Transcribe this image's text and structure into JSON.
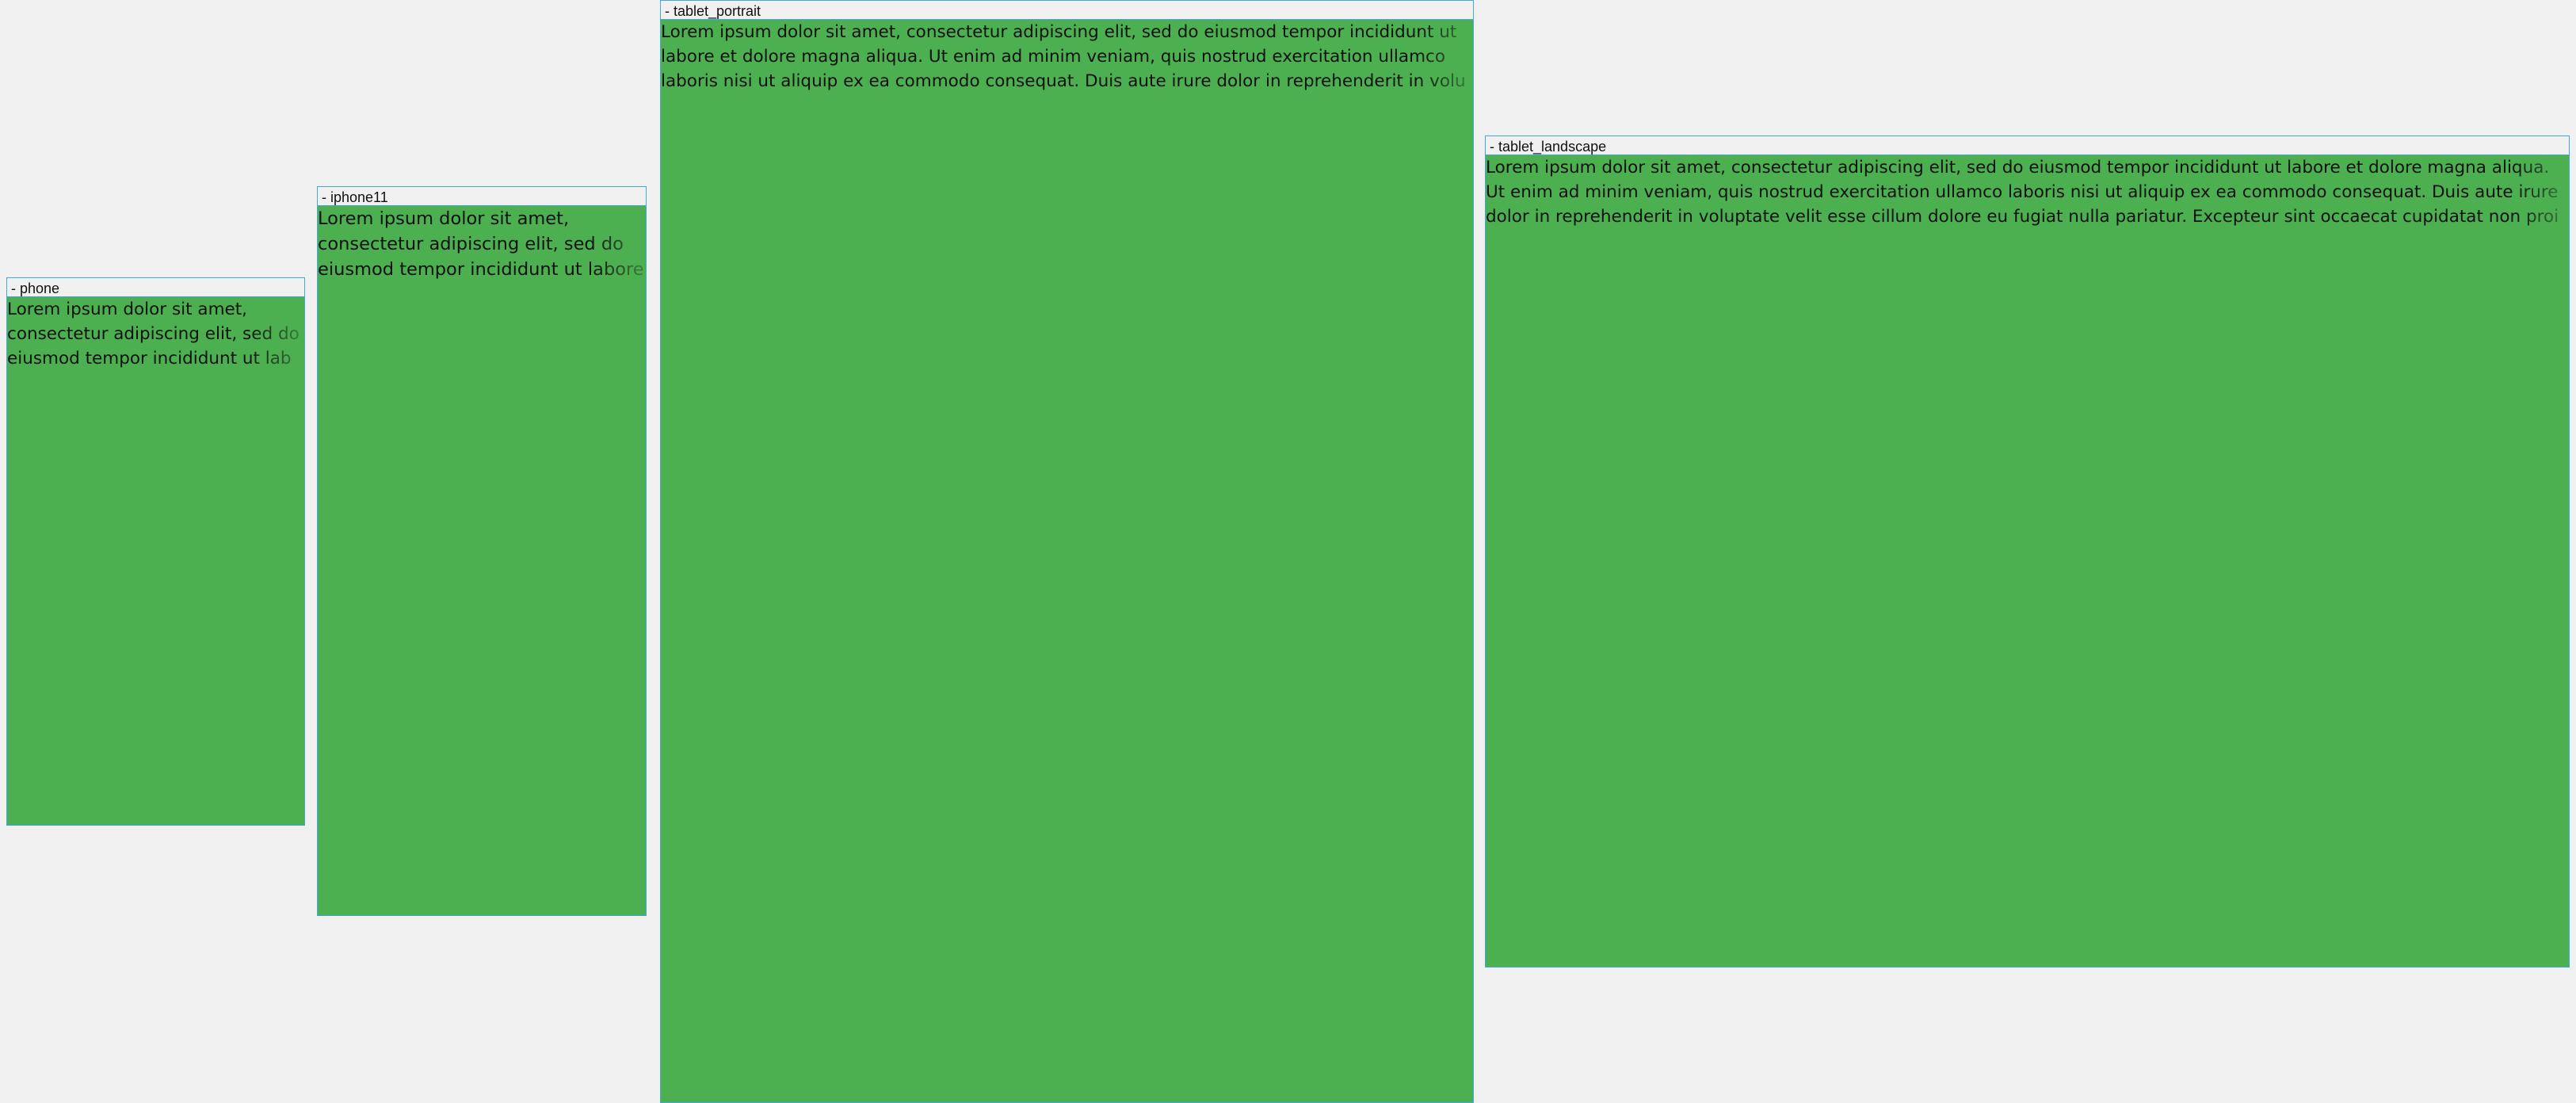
{
  "frames": [
    {
      "label": "- phone",
      "text": "Lorem ipsum dolor sit amet, consectetur adipiscing elit, sed do eiusmod tempor incididunt ut lab"
    },
    {
      "label": "- iphone11",
      "text": "Lorem ipsum dolor sit amet, consectetur adipiscing elit, sed do eiusmod tempor incididunt ut labore"
    },
    {
      "label": "- tablet_portrait",
      "text": "Lorem ipsum dolor sit amet, consectetur adipiscing elit, sed do eiusmod tempor incididunt ut labore et dolore magna aliqua. Ut enim ad minim veniam, quis nostrud exercitation ullamco laboris nisi ut aliquip ex ea commodo consequat. Duis aute irure dolor in reprehenderit in volu"
    },
    {
      "label": "- tablet_landscape",
      "text": "Lorem ipsum dolor sit amet, consectetur adipiscing elit, sed do eiusmod tempor incididunt ut labore et dolore magna aliqua. Ut enim ad minim veniam, quis nostrud exercitation ullamco laboris nisi ut aliquip ex ea commodo consequat. Duis aute irure dolor in reprehenderit in voluptate velit esse cillum dolore eu fugiat nulla pariatur. Excepteur sint occaecat cupidatat non proi"
    }
  ],
  "colors": {
    "canvas_background": "#f0f0f0",
    "frame_fill": "#4caf50",
    "frame_border": "#45a8dc",
    "text": "#111111"
  }
}
